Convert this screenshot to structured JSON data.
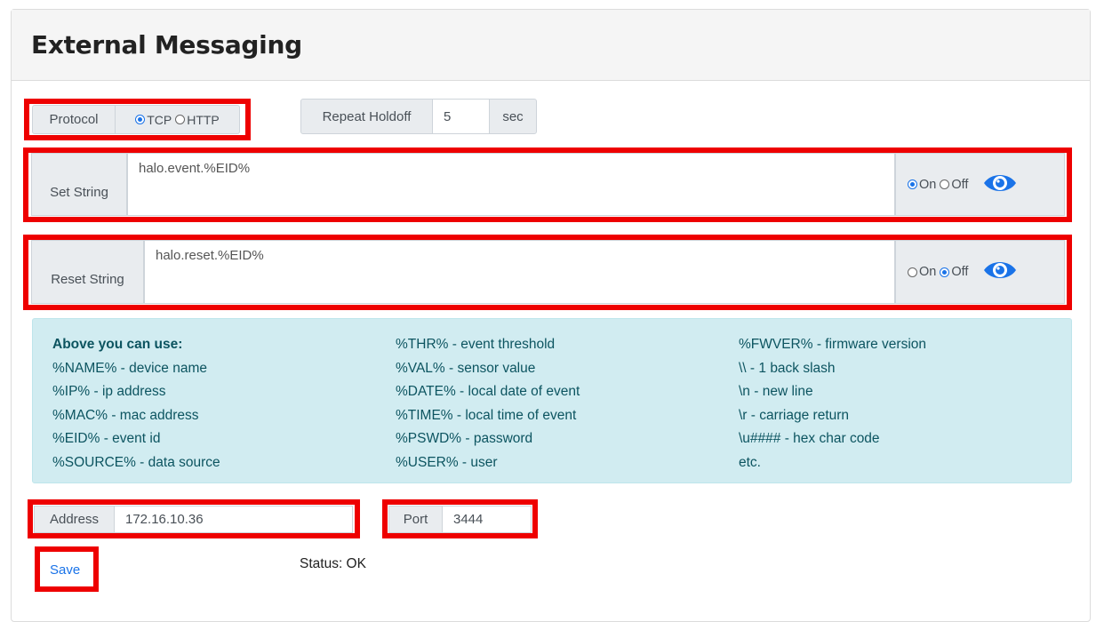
{
  "header": {
    "title": "External Messaging"
  },
  "protocol": {
    "label": "Protocol",
    "options": [
      {
        "label": "TCP",
        "selected": true
      },
      {
        "label": "HTTP",
        "selected": false
      }
    ]
  },
  "repeat_holdoff": {
    "label": "Repeat Holdoff",
    "value": "5",
    "unit": "sec"
  },
  "set_string": {
    "label": "Set String",
    "value": "halo.event.%EID%",
    "on_label": "On",
    "off_label": "Off",
    "state": "on"
  },
  "reset_string": {
    "label": "Reset String",
    "value": "halo.reset.%EID%",
    "on_label": "On",
    "off_label": "Off",
    "state": "off"
  },
  "help": {
    "col1": [
      "Above you can use:",
      "%NAME% - device name",
      "%IP% - ip address",
      "%MAC% - mac address",
      "%EID% - event id",
      "%SOURCE% - data source"
    ],
    "col2": [
      "%THR% - event threshold",
      "%VAL% - sensor value",
      "%DATE% - local date of event",
      "%TIME% - local time of event",
      "%PSWD% - password",
      "%USER% - user"
    ],
    "col3": [
      "%FWVER% - firmware version",
      "\\\\ - 1 back slash",
      "\\n - new line",
      "\\r - carriage return",
      "\\u#### - hex char code",
      "etc."
    ]
  },
  "address": {
    "label": "Address",
    "value": "172.16.10.36"
  },
  "port": {
    "label": "Port",
    "value": "3444"
  },
  "save_label": "Save",
  "status_text": "Status: OK",
  "colors": {
    "highlight": "#ee0000",
    "accent": "#1a73e8",
    "info_bg": "#d1ecf1"
  }
}
